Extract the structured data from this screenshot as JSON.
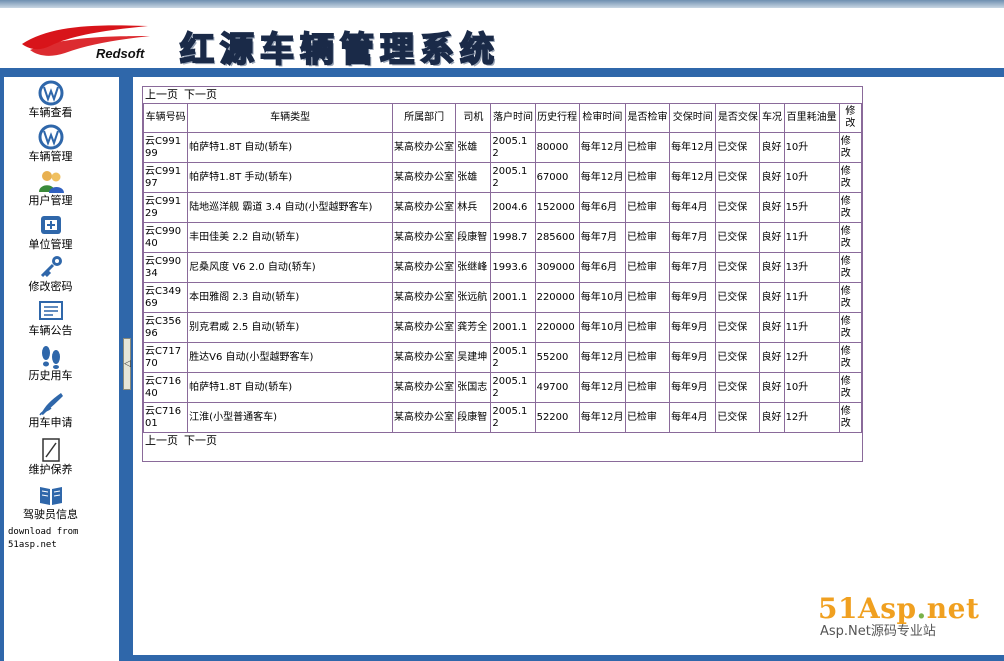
{
  "brand": {
    "logo_text": "Redsoft",
    "title": "红源车辆管理系统"
  },
  "nav": [
    {
      "label": "车辆查看",
      "icon": "vw-badge-icon"
    },
    {
      "label": "车辆管理",
      "icon": "vw-badge-icon"
    },
    {
      "label": "用户管理",
      "icon": "users-icon"
    },
    {
      "label": "单位管理",
      "icon": "unit-icon"
    },
    {
      "label": "修改密码",
      "icon": "key-icon"
    },
    {
      "label": "车辆公告",
      "icon": "notice-icon"
    },
    {
      "label": "历史用车",
      "icon": "footprints-icon"
    },
    {
      "label": "用车申请",
      "icon": "pen-icon"
    },
    {
      "label": "维护保养",
      "icon": "document-icon"
    },
    {
      "label": "驾驶员信息",
      "icon": "book-icon"
    }
  ],
  "download_note": "download from 51asp.net",
  "splitter_glyph": "◁",
  "pager": {
    "prev": "上一页",
    "next": "下一页"
  },
  "table": {
    "headers": [
      "车辆号码",
      "车辆类型",
      "所属部门",
      "司机",
      "落户时间",
      "历史行程",
      "检审时间",
      "是否检审",
      "交保时间",
      "是否交保",
      "车况",
      "百里耗油量",
      "修改"
    ],
    "rows": [
      [
        "云C99199",
        "帕萨特1.8T 自动(轿车)",
        "某高校办公室",
        "张雄",
        "2005.12",
        "80000",
        "每年12月",
        "已检审",
        "每年12月",
        "已交保",
        "良好",
        "10升",
        "修改"
      ],
      [
        "云C99197",
        "帕萨特1.8T 手动(轿车)",
        "某高校办公室",
        "张雄",
        "2005.12",
        "67000",
        "每年12月",
        "已检审",
        "每年12月",
        "已交保",
        "良好",
        "10升",
        "修改"
      ],
      [
        "云C99129",
        "陆地巡洋舰 霸道 3.4 自动(小型越野客车)",
        "某高校办公室",
        "林兵",
        "2004.6",
        "152000",
        "每年6月",
        "已检审",
        "每年4月",
        "已交保",
        "良好",
        "15升",
        "修改"
      ],
      [
        "云C99040",
        "丰田佳美 2.2 自动(轿车)",
        "某高校办公室",
        "段康智",
        "1998.7",
        "285600",
        "每年7月",
        "已检审",
        "每年7月",
        "已交保",
        "良好",
        "11升",
        "修改"
      ],
      [
        "云C99034",
        "尼桑风度 V6 2.0 自动(轿车)",
        "某高校办公室",
        "张继峰",
        "1993.6",
        "309000",
        "每年6月",
        "已检审",
        "每年7月",
        "已交保",
        "良好",
        "13升",
        "修改"
      ],
      [
        "云C34969",
        "本田雅阁 2.3 自动(轿车)",
        "某高校办公室",
        "张远航",
        "2001.1",
        "220000",
        "每年10月",
        "已检审",
        "每年9月",
        "已交保",
        "良好",
        "11升",
        "修改"
      ],
      [
        "云C35696",
        "别克君威 2.5 自动(轿车)",
        "某高校办公室",
        "龚芳全",
        "2001.1",
        "220000",
        "每年10月",
        "已检审",
        "每年9月",
        "已交保",
        "良好",
        "11升",
        "修改"
      ],
      [
        "云C71770",
        "胜达V6 自动(小型越野客车)",
        "某高校办公室",
        "吴建坤",
        "2005.12",
        "55200",
        "每年12月",
        "已检审",
        "每年9月",
        "已交保",
        "良好",
        "12升",
        "修改"
      ],
      [
        "云C71640",
        "帕萨特1.8T 自动(轿车)",
        "某高校办公室",
        "张国志",
        "2005.12",
        "49700",
        "每年12月",
        "已检审",
        "每年9月",
        "已交保",
        "良好",
        "10升",
        "修改"
      ],
      [
        "云C71601",
        "江淮(小型普通客车)",
        "某高校办公室",
        "段康智",
        "2005.12",
        "52200",
        "每年12月",
        "已检审",
        "每年4月",
        "已交保",
        "良好",
        "12升",
        "修改"
      ]
    ]
  },
  "watermark": {
    "site_main": "51Asp",
    "site_dot": ".",
    "site_tld": "net",
    "tagline": "Asp.Net源码专业站"
  },
  "colors": {
    "band": "#2f67aa",
    "grid_border": "#8a6a9a",
    "watermark_orange": "#f0a020",
    "watermark_green": "#79b24a"
  }
}
